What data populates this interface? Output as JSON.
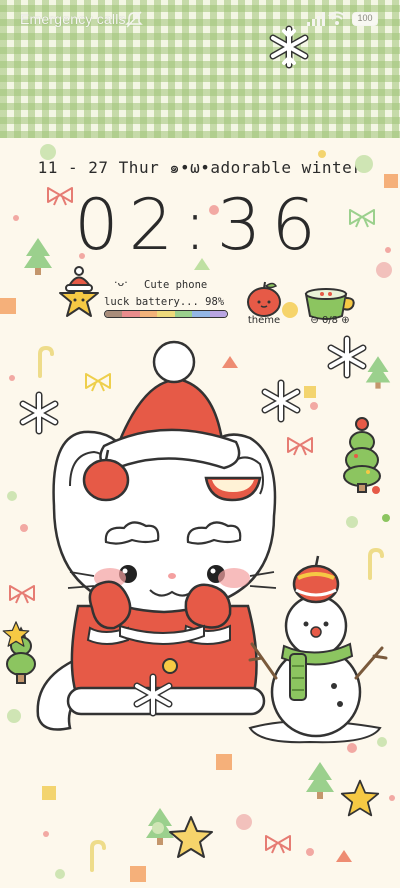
{
  "status_bar": {
    "carrier_text": "Emergency calls",
    "battery_level": "100",
    "icons": [
      "mute-icon",
      "signal-icon",
      "wifi-icon",
      "battery-icon"
    ]
  },
  "lock_screen": {
    "date_text": "11 - 27 Thur ๑•ω•adorable winter",
    "time_text": "02:36"
  },
  "battery_widget": {
    "face": "·ᴗ·",
    "title": "Cute phone",
    "subtitle": "luck battery...  98%",
    "bar_colors": [
      "#a98d7a",
      "#e98c8c",
      "#f2b37a",
      "#eeda7c",
      "#9bd08d",
      "#93b7e6",
      "#b9a5e2"
    ]
  },
  "theme_app": {
    "label": "theme"
  },
  "counter_widget": {
    "label": "⊖ 0/8 ⊕"
  },
  "colors": {
    "background": "#fdf8ec",
    "gingham": "#a0c478",
    "santa_red": "#e65a47",
    "snowman_scarf": "#8cc560"
  }
}
